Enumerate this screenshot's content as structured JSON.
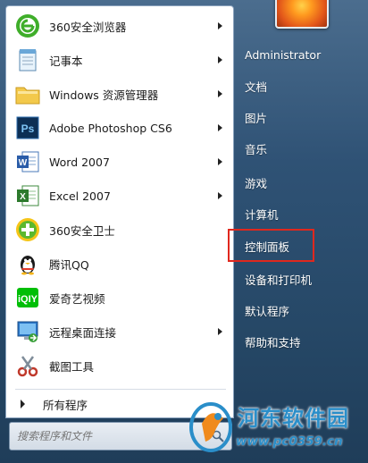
{
  "programs": [
    {
      "label": "360安全浏览器",
      "icon": "360-browser-icon",
      "has_submenu": true
    },
    {
      "label": "记事本",
      "icon": "notepad-icon",
      "has_submenu": true
    },
    {
      "label": "Windows 资源管理器",
      "icon": "explorer-folder-icon",
      "has_submenu": true
    },
    {
      "label": "Adobe Photoshop CS6",
      "icon": "photoshop-icon",
      "has_submenu": true
    },
    {
      "label": "Word 2007",
      "icon": "word-icon",
      "has_submenu": true
    },
    {
      "label": "Excel 2007",
      "icon": "excel-icon",
      "has_submenu": true
    },
    {
      "label": "360安全卫士",
      "icon": "360-safe-icon",
      "has_submenu": false
    },
    {
      "label": "腾讯QQ",
      "icon": "qq-penguin-icon",
      "has_submenu": false
    },
    {
      "label": "爱奇艺视频",
      "icon": "iqiyi-icon",
      "has_submenu": false
    },
    {
      "label": "远程桌面连接",
      "icon": "remote-desktop-icon",
      "has_submenu": true
    },
    {
      "label": "截图工具",
      "icon": "scissors-icon",
      "has_submenu": false
    }
  ],
  "all_programs": {
    "label": "所有程序"
  },
  "search": {
    "placeholder": "搜索程序和文件"
  },
  "right": {
    "user": "Administrator",
    "items": [
      "文档",
      "图片",
      "音乐",
      "游戏",
      "计算机",
      "控制面板",
      "设备和打印机",
      "默认程序",
      "帮助和支持"
    ],
    "highlighted": "控制面板"
  },
  "watermark": {
    "title": "河东软件园",
    "url": "www.pc0359.cn"
  },
  "colors": {
    "panel_bg": "#ffffff",
    "right_bg": "#2f5275",
    "highlight": "#e0281e",
    "watermark": "#2a8ec9"
  }
}
